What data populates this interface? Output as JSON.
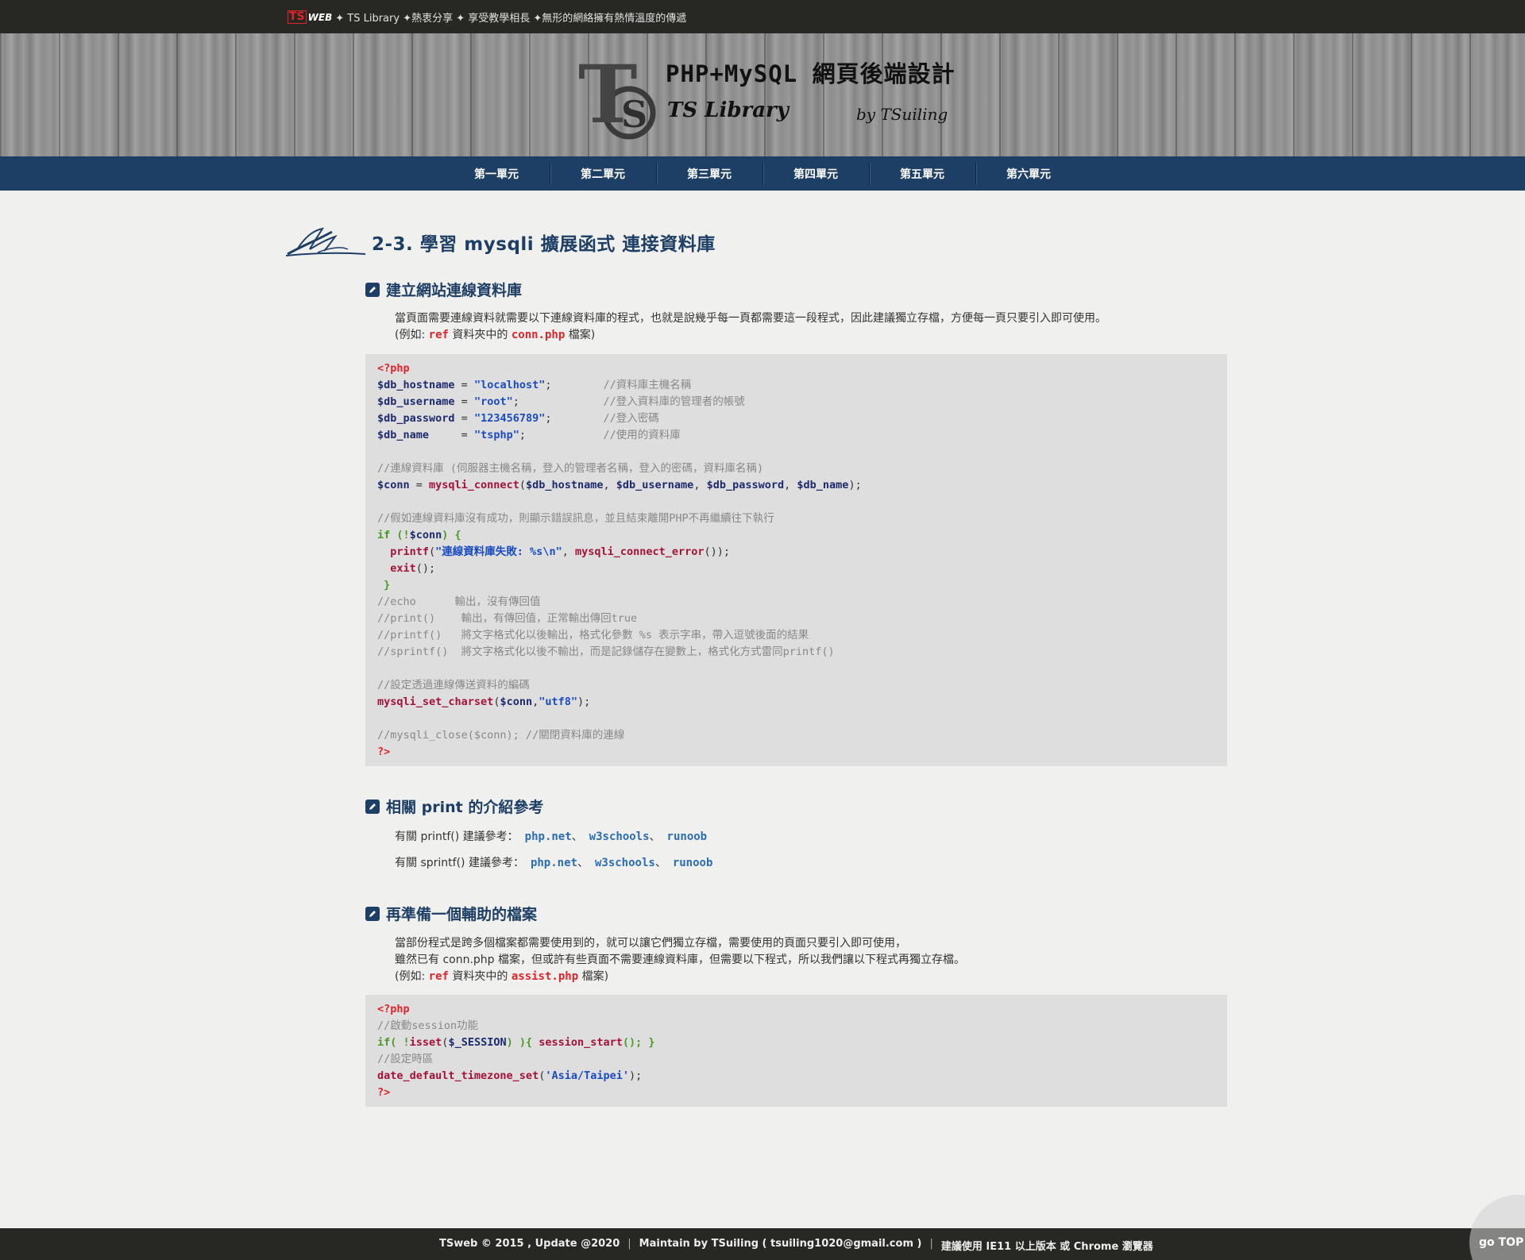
{
  "topbar": {
    "logo": "TS",
    "web": "WEB",
    "text": "✦ TS Library ✦熱衷分享 ✦ 享受教學相長 ✦無形的網絡擁有熱情溫度的傳遞"
  },
  "banner": {
    "title": "PHP+MySQL 網頁後端設計",
    "subtitle": "TS Library",
    "by": "by TSuiling",
    "logo_letters": "TS"
  },
  "nav": {
    "items": [
      "第一單元",
      "第二單元",
      "第三單元",
      "第四單元",
      "第五單元",
      "第六單元"
    ]
  },
  "page": {
    "heading": "2-3. 學習 mysqli 擴展函式 連接資料庫"
  },
  "section1": {
    "title": "建立網站連線資料庫",
    "line1": "當頁面需要連線資料就需要以下連線資料庫的程式，也就是說幾乎每一頁都需要這一段程式，因此建議獨立存檔，方便每一頁只要引入即可使用。",
    "line2_pre": "(例如: ",
    "line2_ref": "ref",
    "line2_mid": " 資料夾中的 ",
    "line2_file": "conn.php",
    "line2_post": " 檔案)"
  },
  "code1": {
    "l1": "<?php",
    "l2a": "$db_hostname",
    "l2b": " = ",
    "l2c": "\"localhost\"",
    "l2d": ";        ",
    "l2e": "//資料庫主機名稱",
    "l3a": "$db_username",
    "l3b": " = ",
    "l3c": "\"root\"",
    "l3d": ";             ",
    "l3e": "//登入資料庫的管理者的帳號",
    "l4a": "$db_password",
    "l4b": " = ",
    "l4c": "\"123456789\"",
    "l4d": ";        ",
    "l4e": "//登入密碼",
    "l5a": "$db_name",
    "l5b": "     = ",
    "l5c": "\"tsphp\"",
    "l5d": ";            ",
    "l5e": "//使用的資料庫",
    "l7": "//連線資料庫 (伺服器主機名稱，登入的管理者名稱，登入的密碼，資料庫名稱)",
    "l8a": "$conn",
    "l8b": " = ",
    "l8c": "mysqli_connect",
    "l8d": "(",
    "l8e": "$db_hostname",
    "l8f": ", ",
    "l8g": "$db_username",
    "l8h": ", ",
    "l8i": "$db_password",
    "l8j": ", ",
    "l8k": "$db_name",
    "l8l": ");",
    "l10": "//假如連線資料庫沒有成功，則顯示錯誤訊息，並且結束離開PHP不再繼續往下執行",
    "l11a": "if",
    "l11b": " (!",
    "l11c": "$conn",
    "l11d": ") {",
    "l12a": "  printf",
    "l12b": "(",
    "l12c": "\"連線資料庫失敗: %s\\n\"",
    "l12d": ", ",
    "l12e": "mysqli_connect_error",
    "l12f": "());",
    "l13a": "  exit",
    "l13b": "();",
    "l14": " }",
    "l15": "//echo      輸出，沒有傳回值",
    "l16": "//print()    輸出，有傳回值，正常輸出傳回true",
    "l17": "//printf()   將文字格式化以後輸出，格式化參數 %s 表示字串，帶入逗號後面的結果",
    "l18": "//sprintf()  將文字格式化以後不輸出，而是記錄儲存在變數上，格式化方式雷同printf()",
    "l20": "//設定透過連線傳送資料的編碼",
    "l21a": "mysqli_set_charset",
    "l21b": "(",
    "l21c": "$conn",
    "l21d": ",",
    "l21e": "\"utf8\"",
    "l21f": ");",
    "l23": "//mysqli_close($conn); //關閉資料庫的連線",
    "l24": "?>"
  },
  "section2": {
    "title": "相關 print 的介紹參考",
    "row1_text": "有關 printf() 建議參考：",
    "row2_text": "有關 sprintf() 建議參考：",
    "links": [
      "php.net",
      "w3schools",
      "runoob"
    ],
    "sep": "、"
  },
  "section3": {
    "title": "再準備一個輔助的檔案",
    "line1": "當部份程式是跨多個檔案都需要使用到的，就可以讓它們獨立存檔，需要使用的頁面只要引入即可使用，",
    "line2": "雖然已有 conn.php 檔案，但或許有些頁面不需要連線資料庫，但需要以下程式，所以我們讓以下程式再獨立存檔。",
    "line3_pre": "(例如: ",
    "line3_ref": "ref",
    "line3_mid": " 資料夾中的 ",
    "line3_file": "assist.php",
    "line3_post": " 檔案)"
  },
  "code2": {
    "l1": "<?php",
    "l2": "//啟動session功能",
    "l3a": "if",
    "l3b": "( !",
    "l3c": "isset",
    "l3d": "(",
    "l3e": "$_SESSION",
    "l3f": ") ){ ",
    "l3g": "session_start",
    "l3h": "(); }",
    "l4": "//設定時區",
    "l5a": "date_default_timezone_set",
    "l5b": "(",
    "l5c": "'Asia/Taipei'",
    "l5d": ");",
    "l6": "?>"
  },
  "footer": {
    "copyright": "TSweb © 2015 , Update @2020",
    "maintain": "Maintain by TSuiling ( tsuiling1020@gmail.com )",
    "browser": "建議使用 IE11 以上版本 或 Chrome 瀏覽器",
    "sep": "|",
    "gotop": "go TOP"
  },
  "colors": {
    "nav_bg": "#1e3f65",
    "bar_bg": "#272723",
    "accent_red": "#e0242a",
    "heading": "#1e3f65",
    "link": "#2a6db5"
  }
}
